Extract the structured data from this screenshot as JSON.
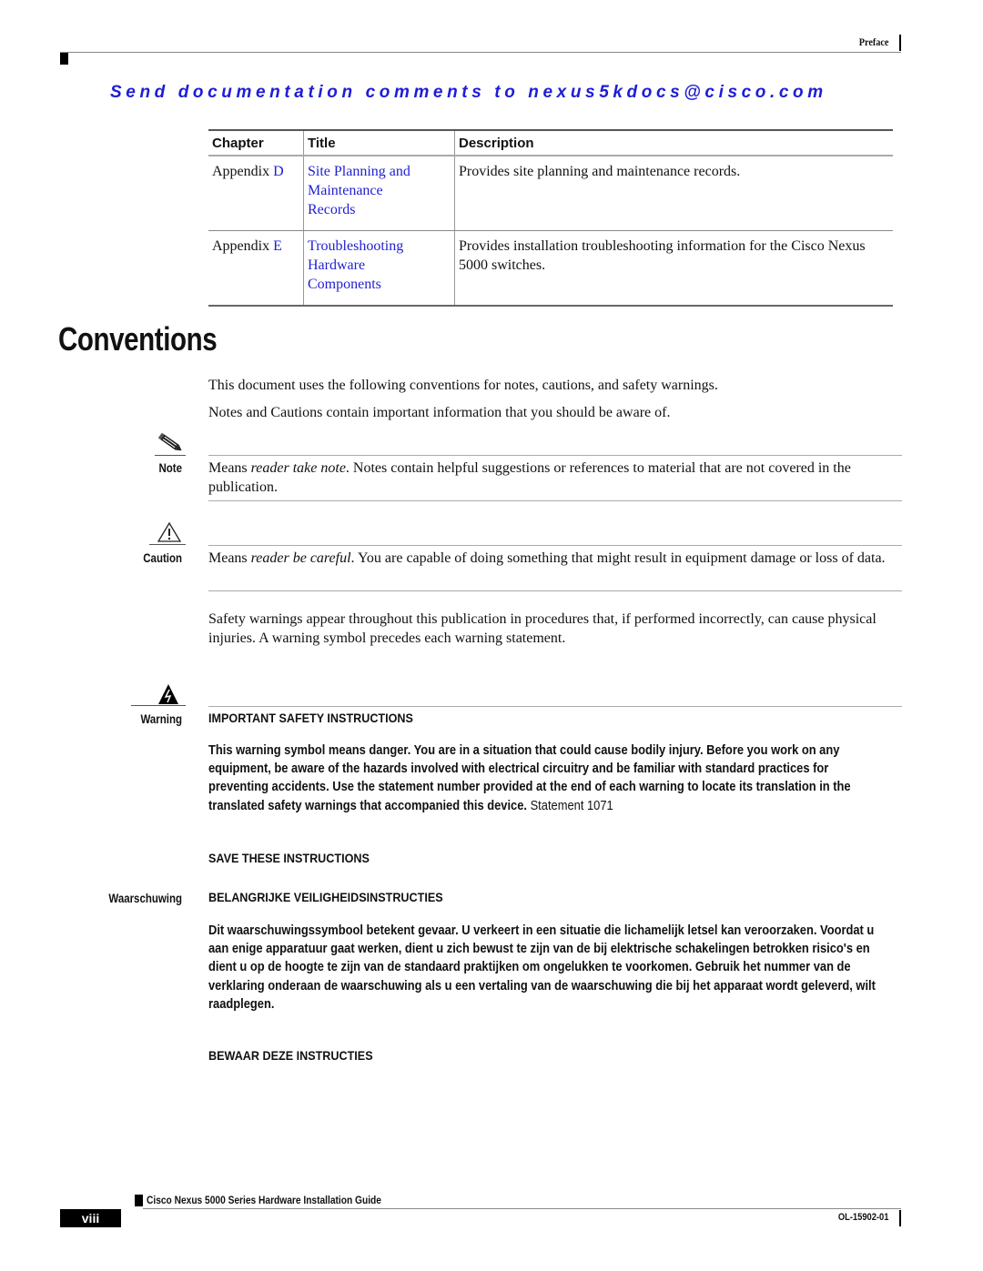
{
  "header": {
    "section": "Preface",
    "send_comments": "Send documentation comments to nexus5kdocs@cisco.com"
  },
  "toc_table": {
    "columns": [
      "Chapter",
      "Title",
      "Description"
    ],
    "rows": [
      {
        "chapter_prefix": "Appendix ",
        "chapter_letter": "D",
        "title_lines": [
          "Site Planning and",
          "Maintenance",
          "Records"
        ],
        "description": "Provides site planning and maintenance records."
      },
      {
        "chapter_prefix": "Appendix ",
        "chapter_letter": "E",
        "title_lines": [
          "Troubleshooting",
          "Hardware",
          "Components"
        ],
        "description": "Provides installation troubleshooting information for the Cisco Nexus 5000 switches."
      }
    ]
  },
  "conventions": {
    "heading": "Conventions",
    "intro1": "This document uses the following conventions for notes, cautions, and safety warnings.",
    "intro2": "Notes and Cautions contain important information that you should be aware of.",
    "note": {
      "label": "Note",
      "pre": "Means ",
      "emph": "reader take note",
      "post": ". Notes contain helpful suggestions or references to material that are not covered in the publication."
    },
    "caution": {
      "label": "Caution",
      "pre": "Means ",
      "emph": "reader be careful",
      "post": ". You are capable of doing something that might result in equipment damage or loss of data."
    },
    "safety_para": "Safety warnings appear throughout this publication in procedures that, if performed incorrectly, can cause physical injuries. A warning symbol precedes each warning statement.",
    "warning": {
      "label": "Warning",
      "heading": "IMPORTANT SAFETY INSTRUCTIONS",
      "body": "This warning symbol means danger. You are in a situation that could cause bodily injury. Before you work on any equipment, be aware of the hazards involved with electrical circuitry and be familiar with standard practices for preventing accidents. Use the statement number provided at the end of each warning to locate its translation in the translated safety warnings that accompanied this device.",
      "statement": " Statement 1071",
      "save": "SAVE THESE INSTRUCTIONS"
    },
    "waarschuwing": {
      "label": "Waarschuwing",
      "heading": "BELANGRIJKE VEILIGHEIDSINSTRUCTIES",
      "body": "Dit waarschuwingssymbool betekent gevaar. U verkeert in een situatie die lichamelijk letsel kan veroorzaken. Voordat u aan enige apparatuur gaat werken, dient u zich bewust te zijn van de bij elektrische schakelingen betrokken risico's en dient u op de hoogte te zijn van de standaard praktijken om ongelukken te voorkomen. Gebruik het nummer van de verklaring onderaan de waarschuwing als u een vertaling van de waarschuwing die bij het apparaat wordt geleverd, wilt raadplegen.",
      "save": "BEWAAR DEZE INSTRUCTIES"
    }
  },
  "footer": {
    "guide_title": "Cisco Nexus 5000 Series Hardware Installation Guide",
    "page_number": "viii",
    "doc_number": "OL-15902-01"
  },
  "colors": {
    "link": "#1f1fd0",
    "send_comments": "#1d1dd6"
  }
}
